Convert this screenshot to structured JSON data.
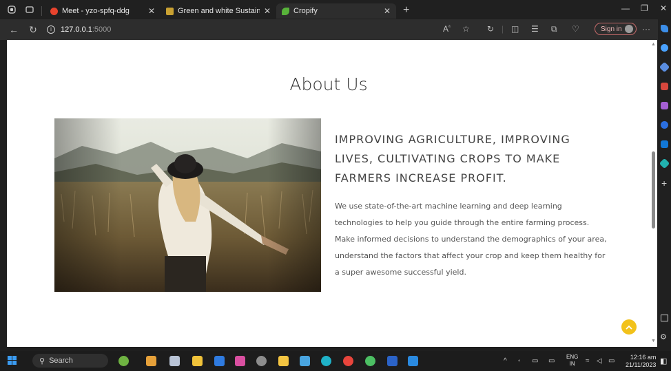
{
  "browser": {
    "tabs": [
      {
        "title": "Meet - yzo-spfq-ddg",
        "active": false,
        "icon": "meet-icon"
      },
      {
        "title": "Green and white Sustainability m",
        "active": false,
        "icon": "slides-icon"
      },
      {
        "title": "Cropify",
        "active": true,
        "icon": "leaf-icon"
      }
    ],
    "url_host": "127.0.0.1",
    "url_port": ":5000",
    "reader_label": "A",
    "signin_label": "Sign in",
    "colors": {
      "tabbar": "#202020",
      "toolbar": "#2d2d2d",
      "accent": "#f2c21b"
    }
  },
  "page": {
    "heading": "About Us",
    "headline": "IMPROVING AGRICULTURE, IMPROVING LIVES, CULTIVATING CROPS TO MAKE FARMERS INCREASE PROFIT.",
    "paragraph": "We use state-of-the-art machine learning and deep learning technologies to help you guide through the entire farming process. Make informed decisions to understand the demographics of your area, understand the factors that affect your crop and keep them healthy for a super awesome successful yield.",
    "photo_alt": "woman in hat walking through wheat field"
  },
  "taskbar": {
    "search_label": "Search",
    "lang": "ENG",
    "region": "IN",
    "time": "12:16 am",
    "date": "21/11/2023"
  }
}
